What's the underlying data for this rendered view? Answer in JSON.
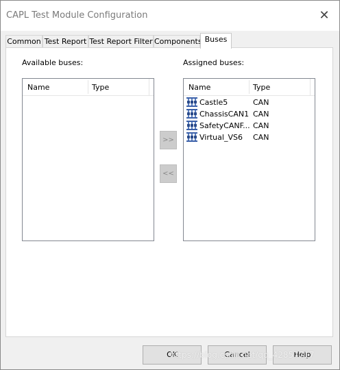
{
  "window": {
    "title": "CAPL Test Module Configuration",
    "close_glyph": "✕"
  },
  "tabs": [
    {
      "label": "Common"
    },
    {
      "label": "Test Report"
    },
    {
      "label": "Test Report Filter"
    },
    {
      "label": "Components"
    },
    {
      "label": "Buses"
    }
  ],
  "active_tab": "Buses",
  "available": {
    "label": "Available buses:",
    "columns": [
      "Name",
      "Type"
    ],
    "rows": []
  },
  "assigned": {
    "label": "Assigned buses:",
    "columns": [
      "Name",
      "Type"
    ],
    "rows": [
      {
        "name": "Castle5",
        "type": "CAN",
        "icon": "bus-network-icon"
      },
      {
        "name": "ChassisCAN1",
        "type": "CAN",
        "icon": "bus-network-icon"
      },
      {
        "name": "SafetyCANF...",
        "type": "CAN",
        "icon": "bus-network-icon"
      },
      {
        "name": "Virtual_VS6",
        "type": "CAN",
        "icon": "bus-network-icon"
      }
    ]
  },
  "transfer": {
    "add_label": ">>",
    "remove_label": "<<"
  },
  "footer": {
    "ok_label": "OK",
    "cancel_label": "Cancel",
    "help_label": "Help"
  },
  "watermark": "https://blog.csdn.net/qq_42857717",
  "colors": {
    "bus_icon": "#3a5fa8",
    "disabled_button": "#cccccc"
  }
}
